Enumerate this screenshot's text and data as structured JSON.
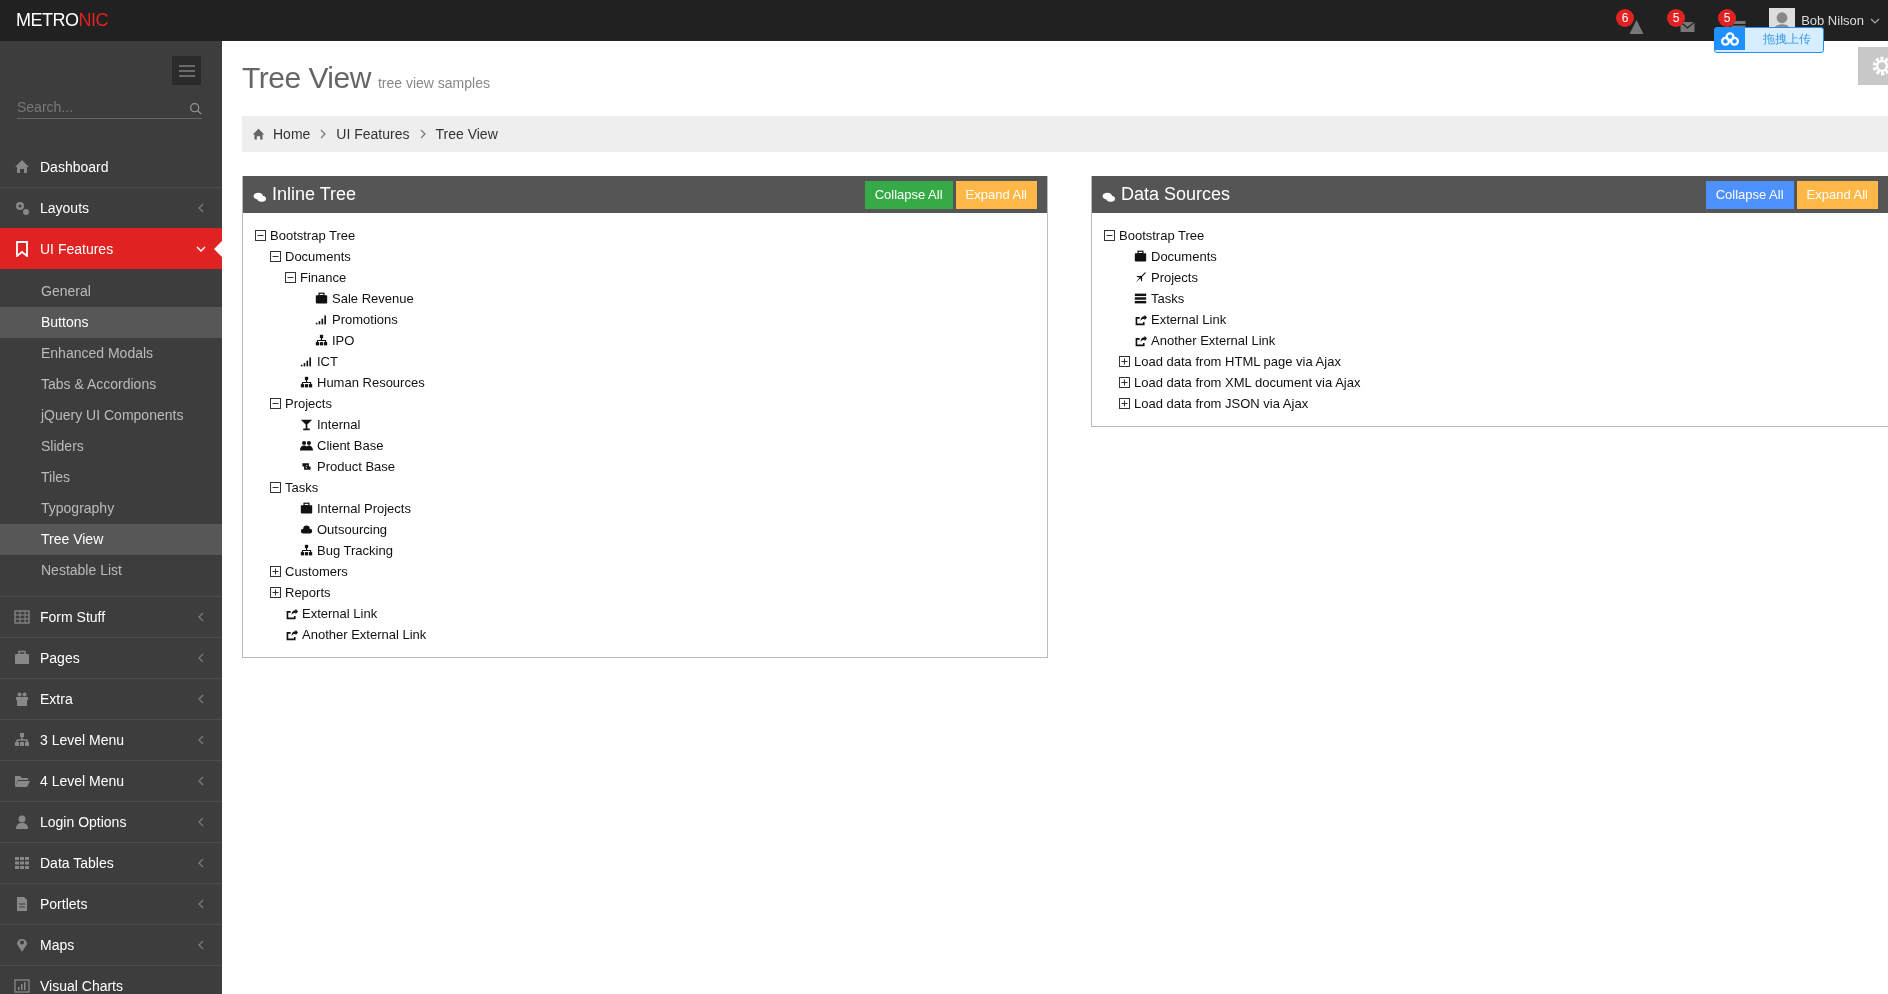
{
  "topbar": {
    "logo": {
      "main": "METRO",
      "accent": "NIC"
    },
    "notifications": [
      {
        "kind": "warning",
        "count": "6"
      },
      {
        "kind": "envelope",
        "count": "5"
      },
      {
        "kind": "tasks",
        "count": "5"
      }
    ],
    "user": {
      "name": "Bob Nilson"
    },
    "upload_widget": {
      "label": "拖拽上传"
    }
  },
  "sidebar": {
    "search": {
      "placeholder": "Search..."
    },
    "items": [
      {
        "kind": "home",
        "label": "Dashboard",
        "selected": false,
        "expandable": false
      },
      {
        "kind": "cogs",
        "label": "Layouts",
        "selected": false,
        "expandable": true,
        "expanded": false
      },
      {
        "kind": "bookmark",
        "label": "UI Features",
        "selected": true,
        "expandable": true,
        "expanded": true,
        "children": [
          {
            "label": "General",
            "selected": false
          },
          {
            "label": "Buttons",
            "selected": true
          },
          {
            "label": "Enhanced Modals",
            "selected": false
          },
          {
            "label": "Tabs & Accordions",
            "selected": false
          },
          {
            "label": "jQuery UI Components",
            "selected": false
          },
          {
            "label": "Sliders",
            "selected": false
          },
          {
            "label": "Tiles",
            "selected": false
          },
          {
            "label": "Typography",
            "selected": false
          },
          {
            "label": "Tree View",
            "selected": true
          },
          {
            "label": "Nestable List",
            "selected": false
          }
        ]
      },
      {
        "kind": "table",
        "label": "Form Stuff",
        "selected": false,
        "expandable": true,
        "expanded": false
      },
      {
        "kind": "briefcase",
        "label": "Pages",
        "selected": false,
        "expandable": true,
        "expanded": false
      },
      {
        "kind": "gift",
        "label": "Extra",
        "selected": false,
        "expandable": true,
        "expanded": false
      },
      {
        "kind": "sitemap",
        "label": "3 Level Menu",
        "selected": false,
        "expandable": true,
        "expanded": false
      },
      {
        "kind": "folder",
        "label": "4 Level Menu",
        "selected": false,
        "expandable": true,
        "expanded": false
      },
      {
        "kind": "user",
        "label": "Login Options",
        "selected": false,
        "expandable": true,
        "expanded": false
      },
      {
        "kind": "grid",
        "label": "Data Tables",
        "selected": false,
        "expandable": true,
        "expanded": false
      },
      {
        "kind": "file",
        "label": "Portlets",
        "selected": false,
        "expandable": true,
        "expanded": false
      },
      {
        "kind": "pin",
        "label": "Maps",
        "selected": false,
        "expandable": true,
        "expanded": false
      },
      {
        "kind": "chart",
        "label": "Visual Charts",
        "selected": false,
        "expandable": false
      }
    ]
  },
  "page": {
    "title": "Tree View",
    "subtitle": "tree view samples",
    "breadcrumb": [
      "Home",
      "UI Features",
      "Tree View"
    ]
  },
  "panels": [
    {
      "title": "Inline Tree",
      "buttons": [
        {
          "label": "Collapse All",
          "kind": "green"
        },
        {
          "label": "Expand All",
          "kind": "yellow"
        }
      ],
      "tree": [
        {
          "kind": "folder",
          "label": "Bootstrap Tree",
          "expanded": true,
          "children": [
            {
              "kind": "folder",
              "label": "Documents",
              "expanded": true,
              "children": [
                {
                  "kind": "folder",
                  "label": "Finance",
                  "expanded": true,
                  "children": [
                    {
                      "kind": "briefcase",
                      "label": "Sale Revenue"
                    },
                    {
                      "kind": "signal",
                      "label": "Promotions"
                    },
                    {
                      "kind": "sitemap",
                      "label": "IPO"
                    }
                  ]
                },
                {
                  "kind": "signal",
                  "label": "ICT"
                },
                {
                  "kind": "sitemap",
                  "label": "Human Resources"
                }
              ]
            },
            {
              "kind": "folder",
              "label": "Projects",
              "expanded": true,
              "children": [
                {
                  "kind": "glass",
                  "label": "Internal"
                },
                {
                  "kind": "users",
                  "label": "Client Base"
                },
                {
                  "kind": "retweet",
                  "label": "Product Base"
                }
              ]
            },
            {
              "kind": "folder",
              "label": "Tasks",
              "expanded": true,
              "children": [
                {
                  "kind": "briefcase",
                  "label": "Internal Projects"
                },
                {
                  "kind": "cloud",
                  "label": "Outsourcing"
                },
                {
                  "kind": "sitemap",
                  "label": "Bug Tracking"
                }
              ]
            },
            {
              "kind": "folder",
              "label": "Customers",
              "expanded": false
            },
            {
              "kind": "folder",
              "label": "Reports",
              "expanded": false
            },
            {
              "kind": "link",
              "label": "External Link"
            },
            {
              "kind": "link",
              "label": "Another External Link"
            }
          ]
        }
      ]
    },
    {
      "title": "Data Sources",
      "buttons": [
        {
          "label": "Collapse All",
          "kind": "blue"
        },
        {
          "label": "Expand All",
          "kind": "yellow"
        }
      ],
      "tree": [
        {
          "kind": "folder",
          "label": "Bootstrap Tree",
          "expanded": true,
          "children": [
            {
              "kind": "briefcase",
              "label": "Documents"
            },
            {
              "kind": "plane",
              "label": "Projects"
            },
            {
              "kind": "tasks",
              "label": "Tasks"
            },
            {
              "kind": "link",
              "label": "External Link"
            },
            {
              "kind": "link",
              "label": "Another External Link"
            },
            {
              "kind": "folder",
              "label": "Load data from HTML page via Ajax",
              "expanded": false
            },
            {
              "kind": "folder",
              "label": "Load data from XML document via Ajax",
              "expanded": false
            },
            {
              "kind": "folder",
              "label": "Load data from JSON via Ajax",
              "expanded": false
            }
          ]
        }
      ]
    }
  ]
}
